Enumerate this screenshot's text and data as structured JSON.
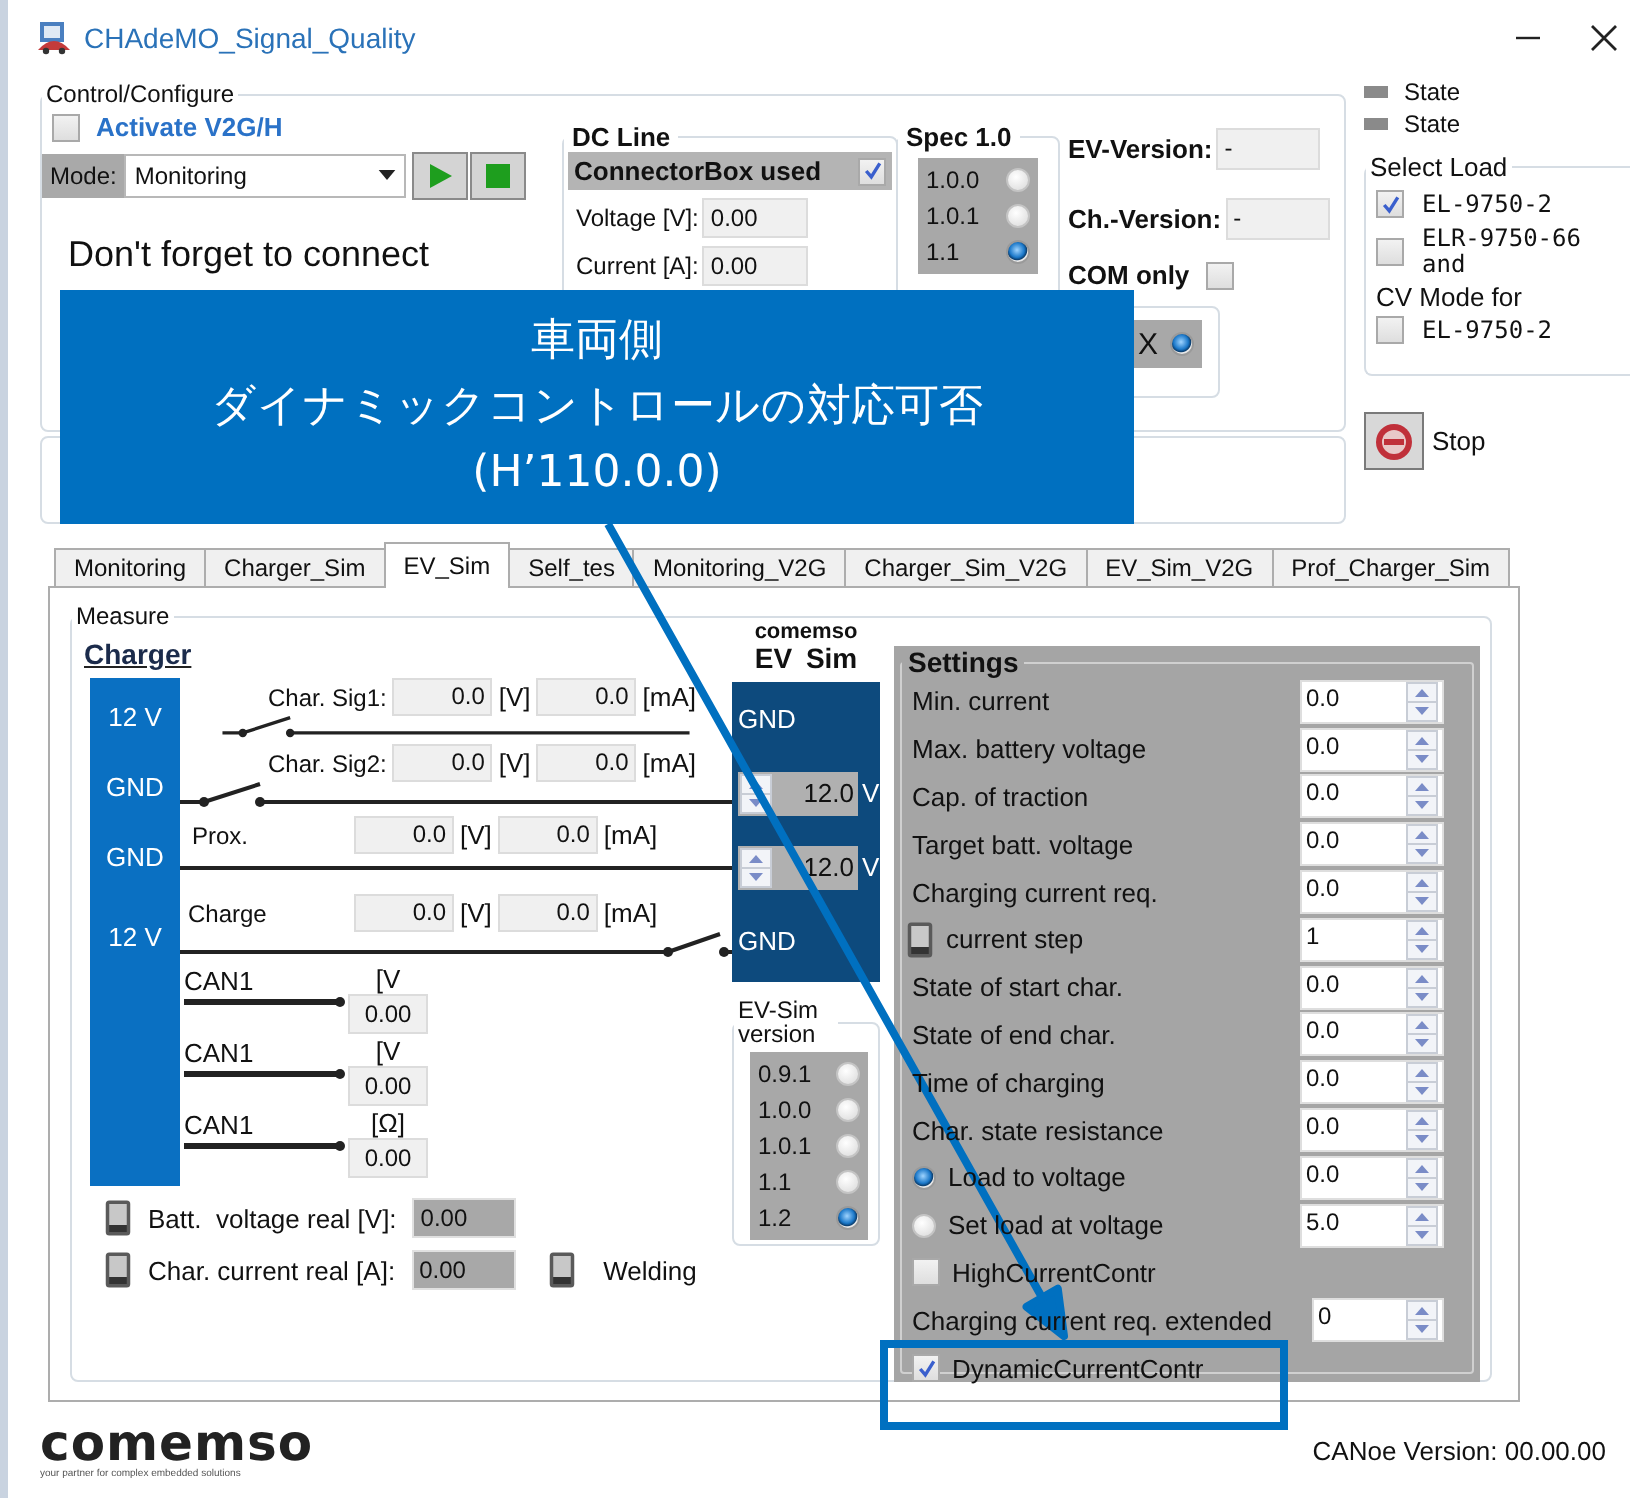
{
  "window": {
    "title": "CHAdeMO_Signal_Quality"
  },
  "control_configure": {
    "title": "Control/Configure",
    "activate": {
      "label": "Activate V2G/H",
      "checked": false
    },
    "mode": {
      "label": "Mode:",
      "value": "Monitoring"
    },
    "message": "Don't forget to connect"
  },
  "dc_line": {
    "title": "DC Line",
    "connector_box": {
      "label": "ConnectorBox used",
      "checked": true
    },
    "fields": [
      {
        "label": "Voltage [V]:",
        "value": "0.00"
      },
      {
        "label": "Current [A]:",
        "value": "0.00"
      }
    ]
  },
  "spec": {
    "title": "Spec 1.0",
    "options": [
      {
        "label": "1.0.0",
        "selected": false
      },
      {
        "label": "1.0.1",
        "selected": false
      },
      {
        "label": "1.1",
        "selected": true
      }
    ]
  },
  "versions": [
    {
      "label": "EV-Version:",
      "value": "-"
    },
    {
      "label": "Ch.-Version:",
      "value": "-"
    }
  ],
  "com_only": {
    "label": "COM only",
    "checked": false
  },
  "x_option": {
    "label": "X",
    "selected": true
  },
  "states": [
    "State",
    "State"
  ],
  "select_load": {
    "title": "Select Load",
    "options": [
      {
        "label": "EL-9750-2",
        "checked": true
      },
      {
        "label": "ELR-9750-66 and",
        "checked": false
      }
    ],
    "cv_mode": {
      "label": "CV Mode for",
      "option": {
        "label": "EL-9750-2",
        "checked": false
      }
    }
  },
  "stop": {
    "label": "Stop"
  },
  "tabs": [
    {
      "label": "Monitoring",
      "selected": false
    },
    {
      "label": "Charger_Sim",
      "selected": false
    },
    {
      "label": "EV_Sim",
      "selected": true
    },
    {
      "label": "Self_tes",
      "selected": false
    },
    {
      "label": "Monitoring_V2G",
      "selected": false
    },
    {
      "label": "Charger_Sim_V2G",
      "selected": false
    },
    {
      "label": "EV_Sim_V2G",
      "selected": false
    },
    {
      "label": "Prof_Charger_Sim",
      "selected": false
    }
  ],
  "measure": {
    "title": "Measure",
    "charger": {
      "title": "Charger",
      "pins": [
        "12 V",
        "GND",
        "GND",
        "12 V"
      ]
    },
    "signals": [
      {
        "kind": "switch_left",
        "label": "Char. Sig1:",
        "voltage": "0.0",
        "voltage_unit": "[V]",
        "current": "0.0",
        "current_unit": "[mA]"
      },
      {
        "kind": "switch_left",
        "label": "Char. Sig2:",
        "voltage": "0.0",
        "voltage_unit": "[V]",
        "current": "0.0",
        "current_unit": "[mA]"
      },
      {
        "kind": "plain",
        "label": "Prox.",
        "voltage": "0.0",
        "voltage_unit": "[V]",
        "current": "0.0",
        "current_unit": "[mA]"
      },
      {
        "kind": "switch_right",
        "label": "Charge",
        "voltage": "0.0",
        "voltage_unit": "[V]",
        "current": "0.0",
        "current_unit": "[mA]"
      }
    ],
    "can": [
      {
        "label": "CAN1",
        "unit": "[V",
        "value": "0.00"
      },
      {
        "label": "CAN1",
        "unit": "[V",
        "value": "0.00"
      },
      {
        "label": "CAN1",
        "unit": "[Ω]",
        "value": "0.00"
      }
    ],
    "readouts": [
      {
        "label": "Batt.  voltage real [V]:",
        "value": "0.00"
      },
      {
        "label": "Char. current real [A]:",
        "value": "0.00"
      }
    ],
    "welding": "Welding",
    "ev_sim": {
      "brand": "comemso",
      "title": "EV Sim",
      "pins": [
        {
          "kind": "label",
          "text": "GND"
        },
        {
          "kind": "spin",
          "value": "12.0",
          "unit": "V"
        },
        {
          "kind": "spin",
          "value": "12.0",
          "unit": "V"
        },
        {
          "kind": "label",
          "text": "GND"
        }
      ]
    },
    "ev_sim_version": {
      "title": "EV-Sim version",
      "options": [
        {
          "label": "0.9.1",
          "selected": false
        },
        {
          "label": "1.0.0",
          "selected": false
        },
        {
          "label": "1.0.1",
          "selected": false
        },
        {
          "label": "1.1",
          "selected": false
        },
        {
          "label": "1.2",
          "selected": true
        }
      ]
    }
  },
  "settings": {
    "title": "Settings",
    "rows": [
      {
        "kind": "spin",
        "label": "Min. current",
        "value": "0.0"
      },
      {
        "kind": "spin",
        "label": "Max. battery voltage",
        "value": "0.0"
      },
      {
        "kind": "spin",
        "label": "Cap. of traction",
        "value": "0.0"
      },
      {
        "kind": "spin",
        "label": "Target batt. voltage",
        "value": "0.0"
      },
      {
        "kind": "spin",
        "label": "Charging current req.",
        "value": "0.0"
      },
      {
        "kind": "toggle_spin",
        "label": "current step",
        "value": "1"
      },
      {
        "kind": "spin",
        "label": "State of start char.",
        "value": "0.0"
      },
      {
        "kind": "spin",
        "label": "State of end char.",
        "value": "0.0"
      },
      {
        "kind": "spin",
        "label": "Time of charging",
        "value": "0.0"
      },
      {
        "kind": "spin",
        "label": "Char. state resistance",
        "value": "0.0"
      },
      {
        "kind": "radio_spin",
        "label": "Load to voltage",
        "selected": true,
        "value": "0.0"
      },
      {
        "kind": "radio_spin",
        "label": "Set load at voltage",
        "selected": false,
        "value": "5.0"
      },
      {
        "kind": "check",
        "label": "HighCurrentContr",
        "checked": false
      },
      {
        "kind": "spin",
        "label": "Charging current req. extended",
        "value": "0"
      },
      {
        "kind": "check",
        "label": "DynamicCurrentContr",
        "checked": true
      }
    ]
  },
  "footer": {
    "logo": "comemso",
    "tagline": "your partner for complex embedded solutions",
    "version": "CANoe Version: 00.00.00"
  },
  "callout": {
    "title": "車両側",
    "text": "ダイナミックコントロールの対応可否",
    "code": "(H’110.0.0)"
  }
}
